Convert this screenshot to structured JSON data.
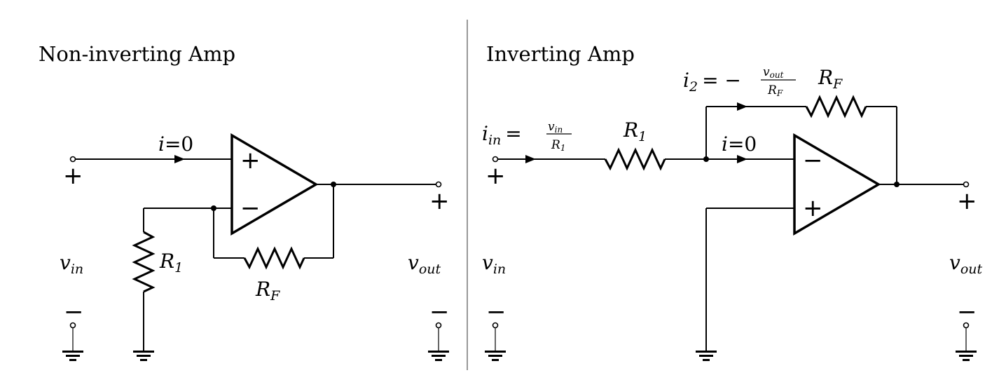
{
  "left": {
    "title": "Non-inverting Amp",
    "current_label": {
      "var": "i",
      "eq": "=0"
    },
    "r1": {
      "base": "R",
      "sub": "1"
    },
    "rf": {
      "base": "R",
      "sub": "F"
    },
    "vin": {
      "base": "v",
      "sub": "in"
    },
    "vout": {
      "base": "v",
      "sub": "out"
    },
    "opamp_top_sign": "+",
    "opamp_bottom_sign": "−",
    "vin_plus": "+",
    "vin_minus": "−",
    "vout_plus": "+",
    "vout_minus": "−"
  },
  "right": {
    "title": "Inverting Amp",
    "iin_label": {
      "var": "i",
      "sub": "in",
      "eq": "=",
      "num": "v",
      "num_sub": "in",
      "den": "R",
      "den_sub": "1"
    },
    "i2_label": {
      "var": "i",
      "sub": "2",
      "eq": "= −",
      "num": "v",
      "num_sub": "out",
      "den": "R",
      "den_sub": "F"
    },
    "current_label": {
      "var": "i",
      "eq": "=0"
    },
    "r1": {
      "base": "R",
      "sub": "1"
    },
    "rf": {
      "base": "R",
      "sub": "F"
    },
    "vin": {
      "base": "v",
      "sub": "in"
    },
    "vout": {
      "base": "v",
      "sub": "out"
    },
    "opamp_top_sign": "−",
    "opamp_bottom_sign": "+",
    "vin_plus": "+",
    "vin_minus": "−",
    "vout_plus": "+",
    "vout_minus": "−"
  }
}
